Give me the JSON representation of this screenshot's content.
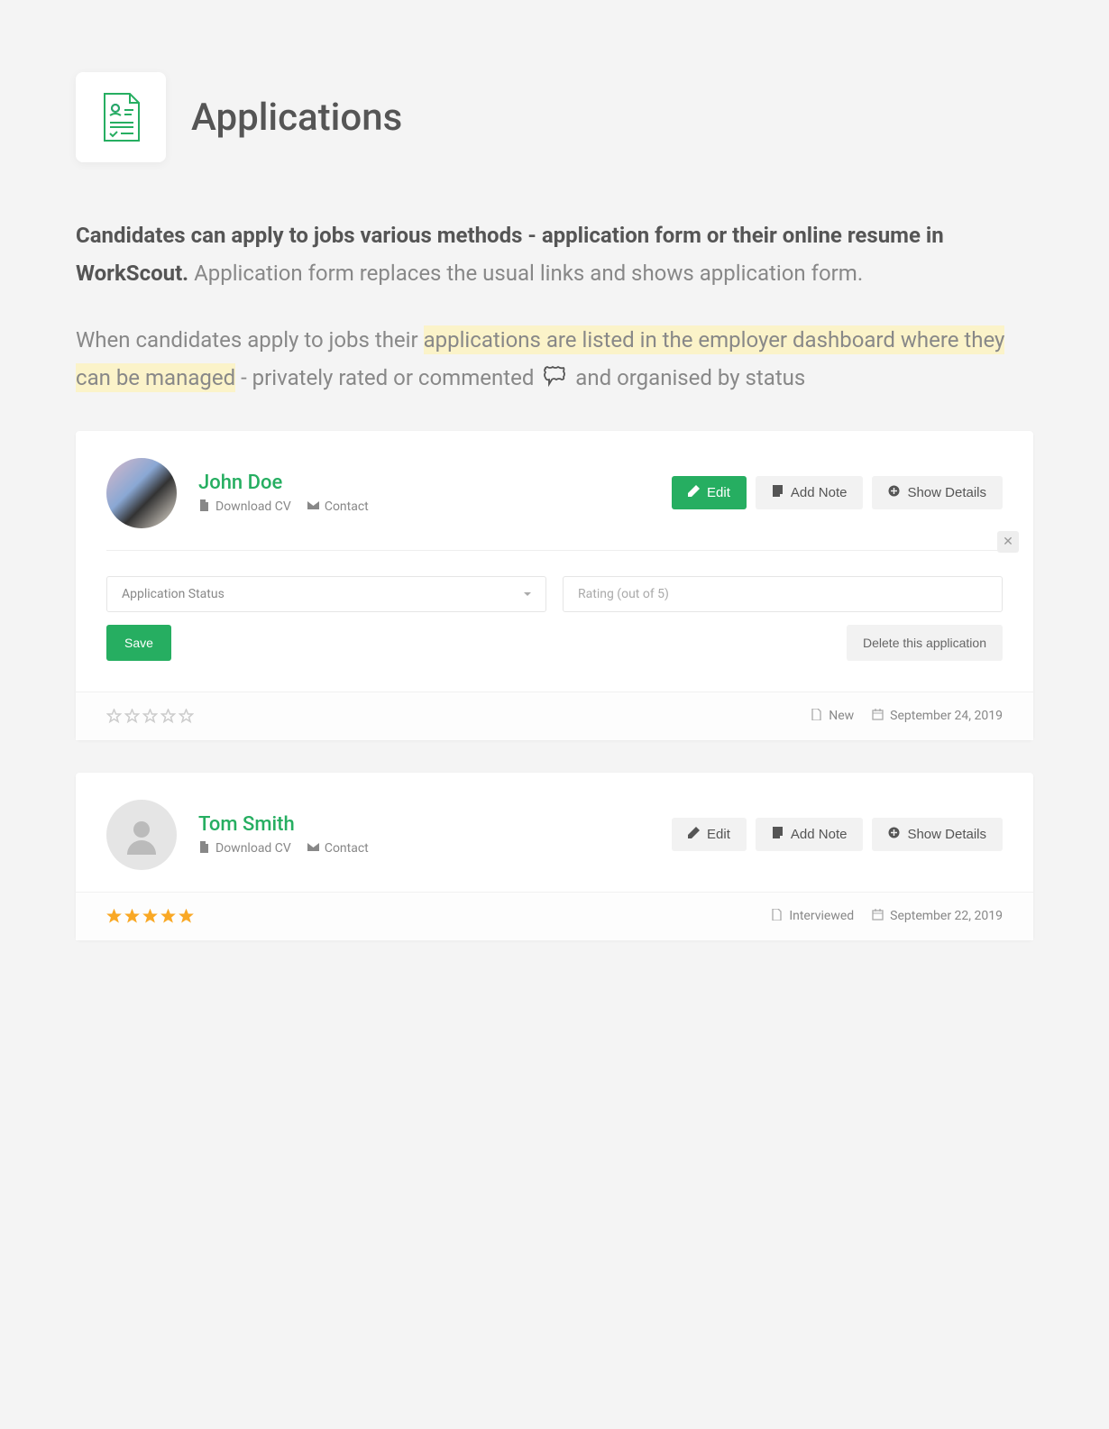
{
  "header": {
    "title": "Applications"
  },
  "intro": {
    "p1_bold": "Candidates can apply to jobs various methods - application form or their online resume in WorkScout.",
    "p1_rest": " Application form replaces the usual links and shows application form.",
    "p2_before": "When candidates apply to jobs their ",
    "p2_highlight": "applications are listed in the employer dashboard where they can be managed",
    "p2_after1": " - privately rated or commented ",
    "p2_after2": " and organised by status"
  },
  "buttons": {
    "edit": "Edit",
    "add_note": "Add Note",
    "show_details": "Show Details",
    "save": "Save",
    "delete": "Delete this application"
  },
  "links": {
    "download_cv": "Download CV",
    "contact": "Contact"
  },
  "form": {
    "status_placeholder": "Application Status",
    "rating_placeholder": "Rating (out of 5)"
  },
  "candidates": [
    {
      "name": "John Doe",
      "has_photo": true,
      "rating": 0,
      "status": "New",
      "date": "September 24, 2019",
      "expanded": true
    },
    {
      "name": "Tom Smith",
      "has_photo": false,
      "rating": 5,
      "status": "Interviewed",
      "date": "September 22, 2019",
      "expanded": false
    }
  ]
}
